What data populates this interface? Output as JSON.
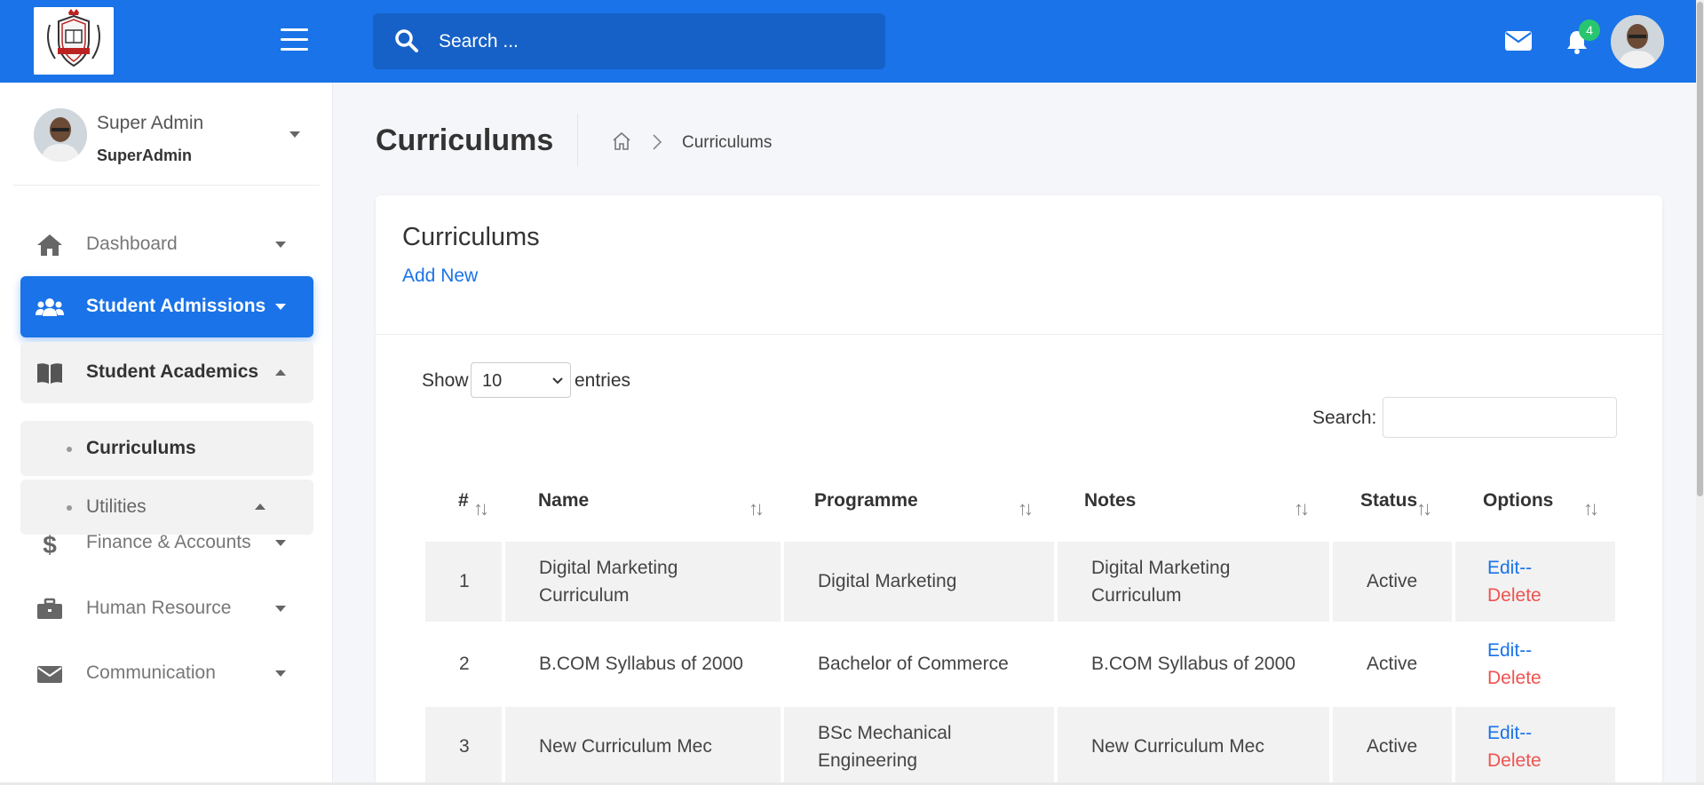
{
  "header": {
    "search_placeholder": "Search ...",
    "notification_count": "4"
  },
  "sidebar": {
    "user": {
      "name": "Super Admin",
      "role": "SuperAdmin"
    },
    "items": [
      {
        "label": "Dashboard",
        "icon": "home-icon",
        "state": "collapsed"
      },
      {
        "label": "Student Admissions",
        "icon": "users-icon",
        "state": "active"
      },
      {
        "label": "Student Academics",
        "icon": "book-icon",
        "state": "open"
      },
      {
        "label": "Finance & Accounts",
        "icon": "dollar-icon",
        "state": "collapsed"
      },
      {
        "label": "Human Resource",
        "icon": "briefcase-icon",
        "state": "collapsed"
      },
      {
        "label": "Communication",
        "icon": "envelope-icon",
        "state": "collapsed"
      }
    ],
    "subitems": [
      {
        "label": "Curriculums",
        "current": true
      },
      {
        "label": "Utilities",
        "current": false
      }
    ]
  },
  "page": {
    "title": "Curriculums",
    "breadcrumb_current": "Curriculums"
  },
  "card": {
    "title": "Curriculums",
    "add_new": "Add New",
    "show_label": "Show",
    "entries_value": "10",
    "entries_label": "entries",
    "search_label": "Search:"
  },
  "table": {
    "columns": [
      "#",
      "Name",
      "Programme",
      "Notes",
      "Status",
      "Options"
    ],
    "rows": [
      {
        "num": "1",
        "name_l1": "Digital Marketing",
        "name_l2": "Curriculum",
        "programme_l1": "Digital Marketing",
        "programme_l2": "",
        "notes_l1": "Digital Marketing",
        "notes_l2": "Curriculum",
        "status": "Active"
      },
      {
        "num": "2",
        "name_l1": "B.COM Syllabus of 2000",
        "name_l2": "",
        "programme_l1": "Bachelor of Commerce",
        "programme_l2": "",
        "notes_l1": "B.COM Syllabus of 2000",
        "notes_l2": "",
        "status": "Active"
      },
      {
        "num": "3",
        "name_l1": "New Curriculum Mec",
        "name_l2": "",
        "programme_l1": "BSc Mechanical",
        "programme_l2": "Engineering",
        "notes_l1": "New Curriculum Mec",
        "notes_l2": "",
        "status": "Active"
      }
    ],
    "edit_label": "Edit",
    "sep_label": "--",
    "delete_label": "Delete"
  },
  "colors": {
    "primary": "#1a73e8",
    "danger": "#ef5350",
    "badge": "#28c76f"
  }
}
